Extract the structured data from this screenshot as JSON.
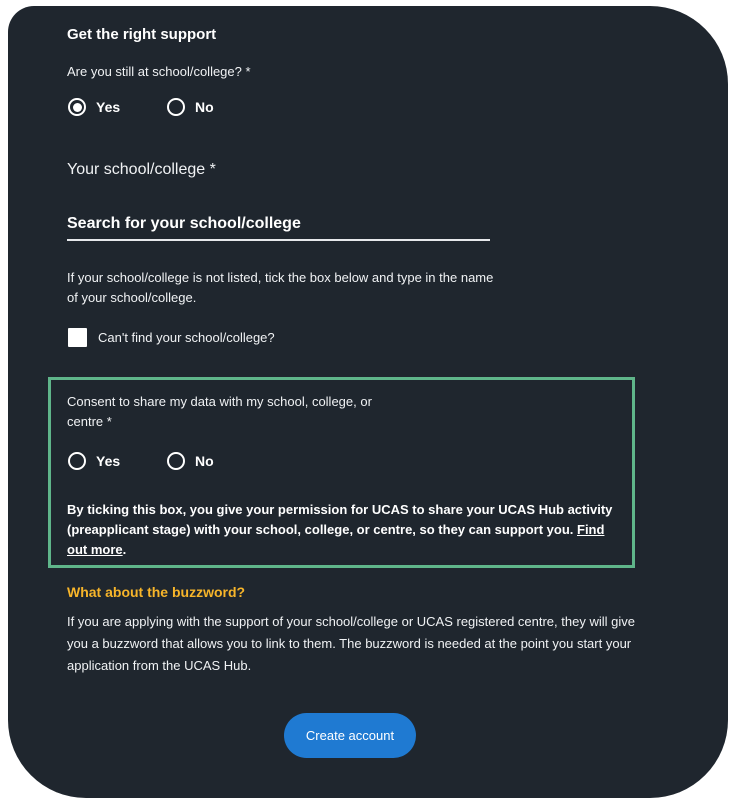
{
  "section_title": "Get the right support",
  "still_at_school": {
    "question": "Are you still at school/college? *",
    "options": [
      {
        "label": "Yes",
        "selected": true
      },
      {
        "label": "No",
        "selected": false
      }
    ]
  },
  "school": {
    "label": "Your school/college *",
    "search_placeholder": "Search for your school/college",
    "search_value": ""
  },
  "not_listed": {
    "hint": "If your school/college is not listed, tick the box below and type in the name of your school/college.",
    "checkbox_label": "Can't find your school/college?",
    "checked": false
  },
  "consent": {
    "question": "Consent to share my data with my school, college, or centre *",
    "options": [
      {
        "label": "Yes",
        "selected": false
      },
      {
        "label": "No",
        "selected": false
      }
    ],
    "note": "By ticking this box, you give your permission for UCAS to share your UCAS Hub activity (preapplicant stage) with your school, college, or centre, so they can support you.",
    "link_text": "Find out more",
    "note_end": "."
  },
  "buzzword": {
    "title": "What about the buzzword?",
    "text": "If you are applying with the support of your school/college or UCAS registered centre, they will give you a buzzword that allows you to link to them. The buzzword is needed at the point you start your application from the UCAS Hub."
  },
  "create_account_label": "Create account",
  "colors": {
    "background": "#1f262e",
    "highlight_border": "#5fb58a",
    "heading_accent": "#f7b52a",
    "button": "#1f7ad2"
  }
}
